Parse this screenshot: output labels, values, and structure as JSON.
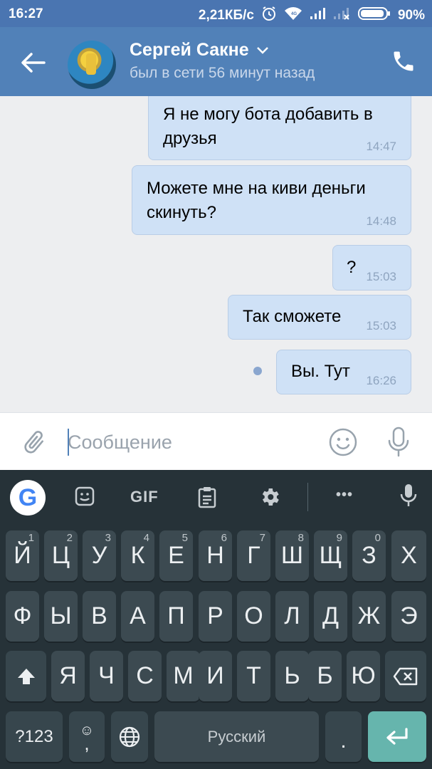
{
  "status_bar": {
    "time": "16:27",
    "network_speed": "2,21КБ/с",
    "battery": "90%",
    "icons": [
      "alarm-icon",
      "wifi-icon",
      "signal-icon",
      "signal-off-icon",
      "battery-icon"
    ]
  },
  "header": {
    "contact_name": "Сергей Сакне",
    "last_seen": "был в сети 56 минут назад",
    "icons": [
      "back-arrow-icon",
      "chevron-down-icon",
      "phone-icon"
    ]
  },
  "messages": [
    {
      "text": "Я не могу бота добавить в друзья",
      "time": "14:47"
    },
    {
      "text": "Можете мне на киви деньги скинуть?",
      "time": "14:48"
    },
    {
      "text": "?",
      "time": "15:03"
    },
    {
      "text": "Так сможете",
      "time": "15:03"
    },
    {
      "text": "Вы. Тут",
      "time": "16:26"
    }
  ],
  "composer": {
    "placeholder": "Сообщение",
    "icons": [
      "paperclip-icon",
      "emoji-icon",
      "microphone-icon"
    ]
  },
  "keyboard": {
    "toolbar": {
      "google_label": "G",
      "gif_label": "GIF",
      "more_label": "•••",
      "icons": [
        "google-icon",
        "sticker-icon",
        "gif-icon",
        "clipboard-icon",
        "settings-icon",
        "more-icon",
        "microphone-icon"
      ]
    },
    "row1": [
      {
        "label": "Й",
        "hint": "1"
      },
      {
        "label": "Ц",
        "hint": "2"
      },
      {
        "label": "У",
        "hint": "3"
      },
      {
        "label": "К",
        "hint": "4"
      },
      {
        "label": "Е",
        "hint": "5"
      },
      {
        "label": "Н",
        "hint": "6"
      },
      {
        "label": "Г",
        "hint": "7"
      },
      {
        "label": "Ш",
        "hint": "8"
      },
      {
        "label": "Щ",
        "hint": "9"
      },
      {
        "label": "З",
        "hint": "0"
      },
      {
        "label": "Х",
        "hint": ""
      }
    ],
    "row2": [
      "Ф",
      "Ы",
      "В",
      "А",
      "П",
      "Р",
      "О",
      "Л",
      "Д",
      "Ж",
      "Э"
    ],
    "row3": [
      "Я",
      "Ч",
      "С",
      "М",
      "И",
      "Т",
      "Ь",
      "Б",
      "Ю"
    ],
    "bottom": {
      "symbols_label": "?123",
      "emoji_key_label": "☺",
      "comma_label": ",",
      "space_label": "Русский",
      "period_label": "."
    }
  },
  "colors": {
    "header": "#5181b8",
    "status_bar": "#4a75b1",
    "bubble": "#cfe1f6",
    "chat_background": "#edeef0",
    "keyboard": "#263238",
    "key": "#3c4a51",
    "enter_key": "#66b5ad"
  }
}
